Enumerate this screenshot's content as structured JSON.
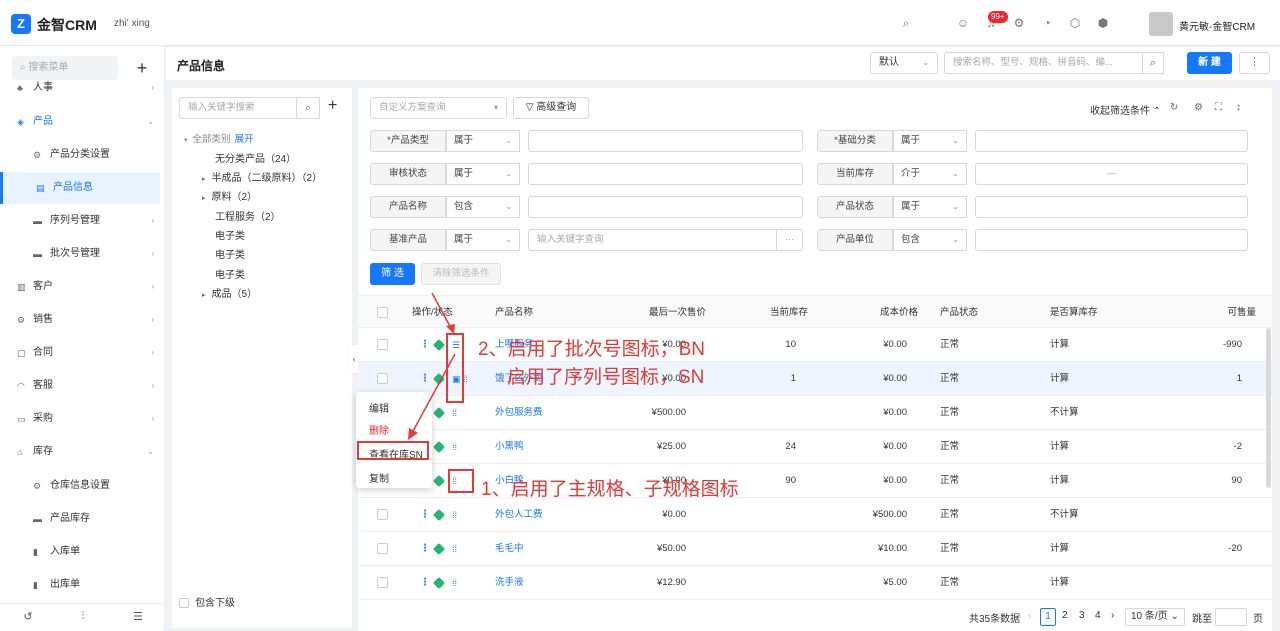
{
  "app": {
    "logo_letter": "Z",
    "name": "金智CRM",
    "tenant": "zhi' xing",
    "user": "黄元敏-金智CRM",
    "notif_count": "99+"
  },
  "sidebar": {
    "search_placeholder": "搜索菜单",
    "plus": "+",
    "items": [
      {
        "label": "人事",
        "icon": "people-icon"
      },
      {
        "label": "产品",
        "icon": "cube-icon"
      },
      {
        "label": "产品分类设置",
        "icon": "gear-icon"
      },
      {
        "label": "产品信息",
        "icon": "doc-icon"
      },
      {
        "label": "序列号管理",
        "icon": "folder-icon"
      },
      {
        "label": "批次号管理",
        "icon": "folder-icon"
      },
      {
        "label": "客户",
        "icon": "chart-icon"
      },
      {
        "label": "销售",
        "icon": "gear-icon"
      },
      {
        "label": "合同",
        "icon": "doc-icon"
      },
      {
        "label": "客服",
        "icon": "headset-icon"
      },
      {
        "label": "采购",
        "icon": "cart-icon"
      },
      {
        "label": "库存",
        "icon": "home-icon"
      },
      {
        "label": "仓库信息设置",
        "icon": "gear-icon"
      },
      {
        "label": "产品库存",
        "icon": "folder-icon"
      },
      {
        "label": "入库单",
        "icon": "in-icon"
      },
      {
        "label": "出库单",
        "icon": "out-icon"
      }
    ]
  },
  "header": {
    "title": "产品信息",
    "view_select": "默认",
    "search_placeholder": "搜索名称、型号、规格、拼音码、编...",
    "new_button": "新 建",
    "more": "⋮"
  },
  "tree": {
    "search_placeholder": "输入关键字搜索",
    "root": "全部类别",
    "expand": "展开",
    "nodes": [
      "无分类产品（24）",
      "半成品（二级原料）（2）",
      "原料（2）",
      "工程服务（2）",
      "电子类",
      "电子类",
      "电子类",
      "成品（5）"
    ],
    "include_sub": "包含下级"
  },
  "filters": {
    "scheme_placeholder": "自定义方案查询",
    "advanced": "高级查询",
    "collapse": "收起筛选条件",
    "rows": [
      {
        "l1": "*产品类型",
        "o1": "属于",
        "l2": "*基础分类",
        "o2": "属于"
      },
      {
        "l1": "审核状态",
        "o1": "属于",
        "l2": "当前库存",
        "o2": "介于",
        "v2": "—"
      },
      {
        "l1": "产品名称",
        "o1": "包含",
        "l2": "产品状态",
        "o2": "属于"
      },
      {
        "l1": "基准产品",
        "o1": "属于",
        "v1": "输入关键字查询",
        "v1b": "···",
        "l2": "产品单位",
        "o2": "包含"
      }
    ],
    "filter_btn": "筛 选",
    "clear_btn": "清除筛选条件"
  },
  "table": {
    "headers": [
      "操作/状态",
      "产品名称",
      "最后一次售价",
      "当前库存",
      "成本价格",
      "产品状态",
      "是否算库存",
      "可售量"
    ],
    "rows": [
      {
        "name": "上哪服务",
        "price": "¥0.00",
        "stock": "10",
        "cost": "¥0.00",
        "status": "正常",
        "calc": "计算",
        "avail": "-990"
      },
      {
        "name": "饿了么外卖",
        "price": "¥0.00",
        "stock": "1",
        "cost": "¥0.00",
        "status": "正常",
        "calc": "计算",
        "avail": "1"
      },
      {
        "name": "外包服务费",
        "price": "¥500.00",
        "stock": "",
        "cost": "¥0.00",
        "status": "正常",
        "calc": "不计算",
        "avail": ""
      },
      {
        "name": "小黑鸭",
        "price": "¥25.00",
        "stock": "24",
        "cost": "¥0.00",
        "status": "正常",
        "calc": "计算",
        "avail": "-2"
      },
      {
        "name": "小白鸭",
        "price": "¥0.00",
        "stock": "90",
        "cost": "¥0.00",
        "status": "正常",
        "calc": "计算",
        "avail": "90"
      },
      {
        "name": "外包人工费",
        "price": "¥0.00",
        "stock": "",
        "cost": "¥500.00",
        "status": "正常",
        "calc": "不计算",
        "avail": ""
      },
      {
        "name": "毛毛中",
        "price": "¥50.00",
        "stock": "",
        "cost": "¥10.00",
        "status": "正常",
        "calc": "计算",
        "avail": "-20"
      },
      {
        "name": "洗手液",
        "price": "¥12.90",
        "stock": "",
        "cost": "¥5.00",
        "status": "正常",
        "calc": "计算",
        "avail": ""
      }
    ]
  },
  "pager": {
    "total": "共35条数据",
    "pages": [
      "1",
      "2",
      "3",
      "4"
    ],
    "size": "10 条/页",
    "goto": "跳至",
    "page_unit": "页"
  },
  "context_menu": {
    "edit": "编辑",
    "delete": "删除",
    "view_sn": "查看在库SN",
    "copy": "复制"
  },
  "annotations": {
    "a1": "1、启用了主规格、子规格图标",
    "a2": "2、启用了批次号图标，BN",
    "a3": "启用了序列号图标，SN"
  },
  "colors": {
    "primary": "#1677ff",
    "annotation": "#e53935",
    "cube": "#22b573"
  }
}
